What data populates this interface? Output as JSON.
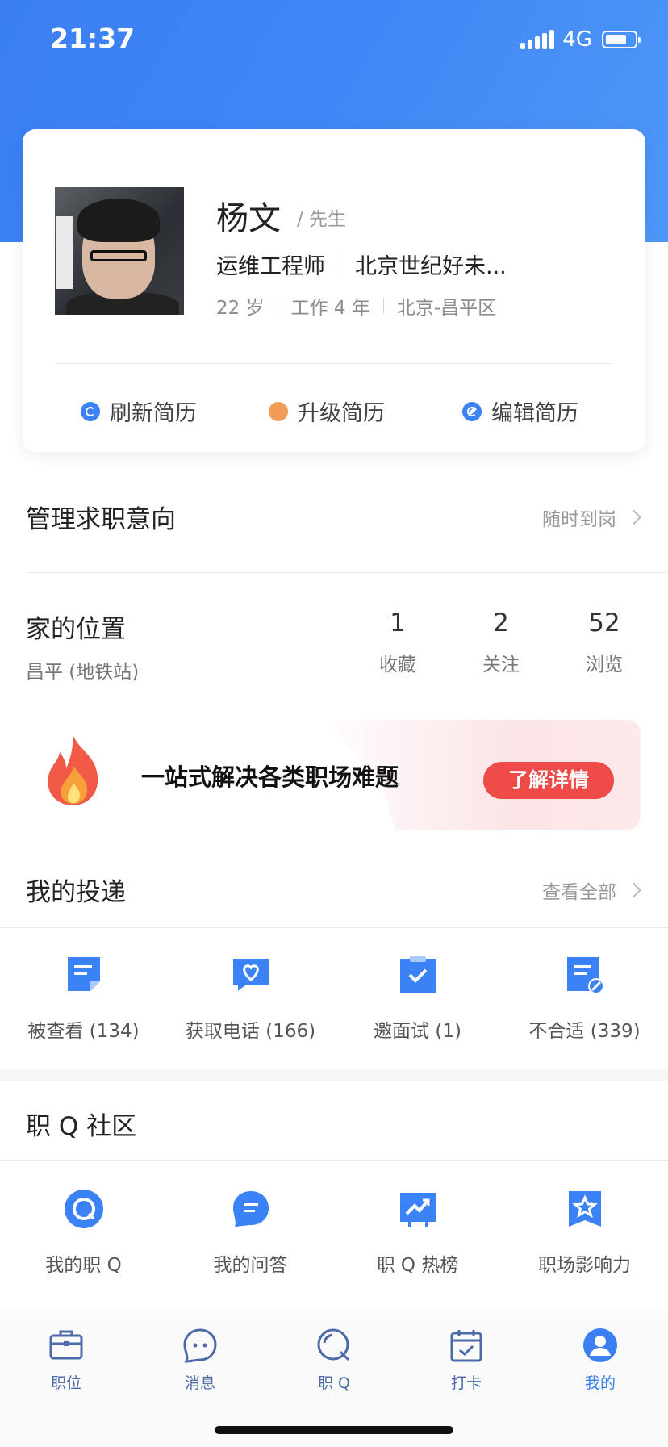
{
  "status_bar": {
    "time": "21:37",
    "network": "4G"
  },
  "profile": {
    "name": "杨文",
    "title_suffix": "/ 先生",
    "position": "运维工程师",
    "company": "北京世纪好未...",
    "age": "22 岁",
    "experience": "工作 4 年",
    "location": "北京-昌平区",
    "actions": [
      "刷新简历",
      "升级简历",
      "编辑简历"
    ]
  },
  "job_intent": {
    "label": "管理求职意向",
    "value": "随时到岗"
  },
  "home": {
    "label": "家的位置",
    "value": "昌平 (地铁站)"
  },
  "stats": [
    {
      "num": "1",
      "label": "收藏"
    },
    {
      "num": "2",
      "label": "关注"
    },
    {
      "num": "52",
      "label": "浏览"
    }
  ],
  "banner": {
    "text": "一站式解决各类职场难题",
    "button": "了解详情"
  },
  "deliveries": {
    "title": "我的投递",
    "more": "查看全部",
    "items": [
      {
        "label": "被查看 (134)",
        "icon": "doc-viewed-icon"
      },
      {
        "label": "获取电话 (166)",
        "icon": "heart-chat-icon"
      },
      {
        "label": "邀面试 (1)",
        "icon": "clipboard-check-icon"
      },
      {
        "label": "不合适 (339)",
        "icon": "doc-rejected-icon"
      }
    ]
  },
  "community": {
    "title": "职 Q 社区",
    "items": [
      {
        "label": "我的职 Q",
        "icon": "q-icon"
      },
      {
        "label": "我的问答",
        "icon": "chat-icon"
      },
      {
        "label": "职 Q 热榜",
        "icon": "trend-icon"
      },
      {
        "label": "职场影响力",
        "icon": "star-badge-icon"
      }
    ]
  },
  "tabbar": [
    {
      "label": "职位",
      "icon": "briefcase-icon"
    },
    {
      "label": "消息",
      "icon": "message-icon"
    },
    {
      "label": "职 Q",
      "icon": "q-icon"
    },
    {
      "label": "打卡",
      "icon": "calendar-check-icon"
    },
    {
      "label": "我的",
      "icon": "user-icon",
      "active": true
    }
  ],
  "colors": {
    "accent": "#3b7ff3",
    "banner_button": "#ee4a48"
  }
}
